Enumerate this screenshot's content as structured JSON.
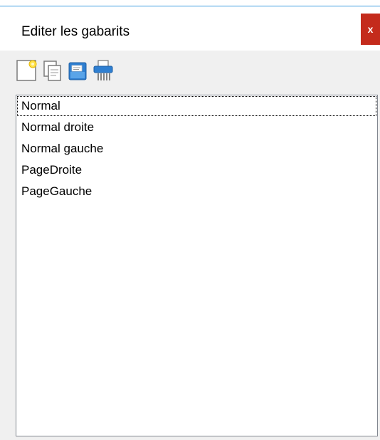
{
  "window": {
    "title": "Editer les gabarits",
    "close_label": "x"
  },
  "toolbar": {
    "buttons": [
      {
        "icon": "new-document-icon",
        "tooltip": ""
      },
      {
        "icon": "duplicate-icon",
        "tooltip": ""
      },
      {
        "icon": "open-folder-icon",
        "tooltip": ""
      },
      {
        "icon": "shredder-icon",
        "tooltip": ""
      }
    ]
  },
  "templates": {
    "items": [
      {
        "label": "Normal",
        "focused": true
      },
      {
        "label": "Normal droite",
        "focused": false
      },
      {
        "label": "Normal gauche",
        "focused": false
      },
      {
        "label": "PageDroite",
        "focused": false
      },
      {
        "label": "PageGauche",
        "focused": false
      }
    ]
  },
  "colors": {
    "close_button": "#c42b1c",
    "accent_line": "#3c9ce0",
    "folder_blue": "#2f7fd1"
  }
}
